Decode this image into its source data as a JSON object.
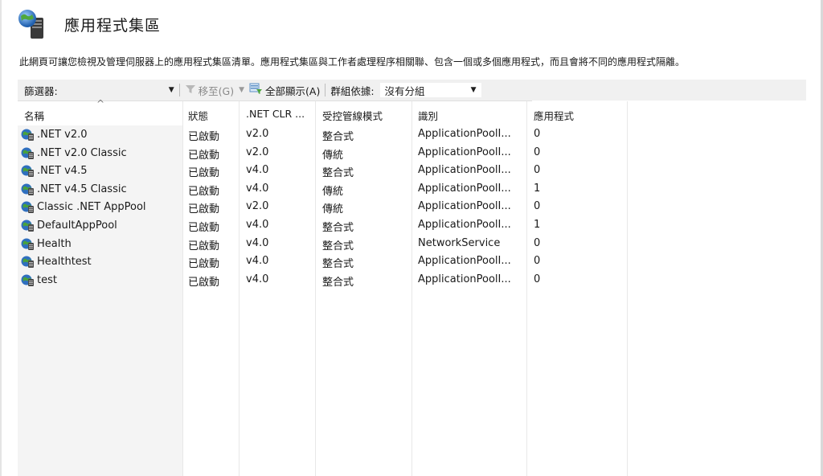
{
  "header": {
    "title": "應用程式集區",
    "description": "此網頁可讓您檢視及管理伺服器上的應用程式集區清單。應用程式集區與工作者處理程序相關聯、包含一個或多個應用程式，而且會將不同的應用程式隔離。"
  },
  "toolbar": {
    "filter_label": "篩選器:",
    "filter_value": "",
    "goto_label": "移至(G)",
    "show_all_label": "全部顯示(A)",
    "groupby_label": "群組依據:",
    "groupby_value": "沒有分組"
  },
  "table": {
    "columns": [
      "名稱",
      "狀態",
      ".NET CLR ...",
      "受控管線模式",
      "識別",
      "應用程式"
    ],
    "rows": [
      {
        "name": ".NET v2.0",
        "status": "已啟動",
        "clr": "v2.0",
        "pipeline": "整合式",
        "identity": "ApplicationPoolI...",
        "apps": "0"
      },
      {
        "name": ".NET v2.0 Classic",
        "status": "已啟動",
        "clr": "v2.0",
        "pipeline": "傳統",
        "identity": "ApplicationPoolI...",
        "apps": "0"
      },
      {
        "name": ".NET v4.5",
        "status": "已啟動",
        "clr": "v4.0",
        "pipeline": "整合式",
        "identity": "ApplicationPoolI...",
        "apps": "0"
      },
      {
        "name": ".NET v4.5 Classic",
        "status": "已啟動",
        "clr": "v4.0",
        "pipeline": "傳統",
        "identity": "ApplicationPoolI...",
        "apps": "1"
      },
      {
        "name": "Classic .NET AppPool",
        "status": "已啟動",
        "clr": "v2.0",
        "pipeline": "傳統",
        "identity": "ApplicationPoolI...",
        "apps": "0"
      },
      {
        "name": "DefaultAppPool",
        "status": "已啟動",
        "clr": "v4.0",
        "pipeline": "整合式",
        "identity": "ApplicationPoolI...",
        "apps": "1"
      },
      {
        "name": "Health",
        "status": "已啟動",
        "clr": "v4.0",
        "pipeline": "整合式",
        "identity": "NetworkService",
        "apps": "0"
      },
      {
        "name": "Healthtest",
        "status": "已啟動",
        "clr": "v4.0",
        "pipeline": "整合式",
        "identity": "ApplicationPoolI...",
        "apps": "0"
      },
      {
        "name": "test",
        "status": "已啟動",
        "clr": "v4.0",
        "pipeline": "整合式",
        "identity": "ApplicationPoolI...",
        "apps": "0"
      }
    ]
  },
  "icons": {
    "header": "app-pools-server-icon",
    "row": "app-pool-icon",
    "filter": "funnel-icon",
    "show_all": "show-all-icon"
  },
  "colors": {
    "toolbar_bg": "#f0f0f0",
    "name_column_bg": "#f4f4f4",
    "icon_blue": "#2f6fbf",
    "icon_green": "#4aa33a"
  }
}
